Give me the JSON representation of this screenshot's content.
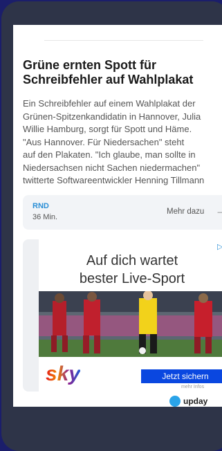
{
  "article": {
    "title": "Grüne ernten Spott für\nSchreibfehler auf Wahlplakat",
    "body": "Ein Schreibfehler auf einem Wahlplakat der\nGrünen-Spitzenkandidatin in Hannover, Julia\nWillie Hamburg, sorgt für Spott und Häme.\n\"Aus Hannover. Für Niedersachen\" steht\nauf den Plakaten. \"Ich glaube, man sollte in\nNiedersachsen nicht Sachen niedermachen\"\ntwitterte Softwareentwickler Henning Tillmann"
  },
  "source": {
    "name": "RND",
    "time": "36 Min.",
    "more_label": "Mehr dazu",
    "more_arrow": "→"
  },
  "ad": {
    "headline": "Auf dich wartet\nbester Live-Sport",
    "adchoices": "▷",
    "close": "✕",
    "brand": "sky",
    "cta_label": "Jetzt sichern",
    "more_info": "mehr Infos"
  },
  "badge": {
    "label": "upday"
  }
}
